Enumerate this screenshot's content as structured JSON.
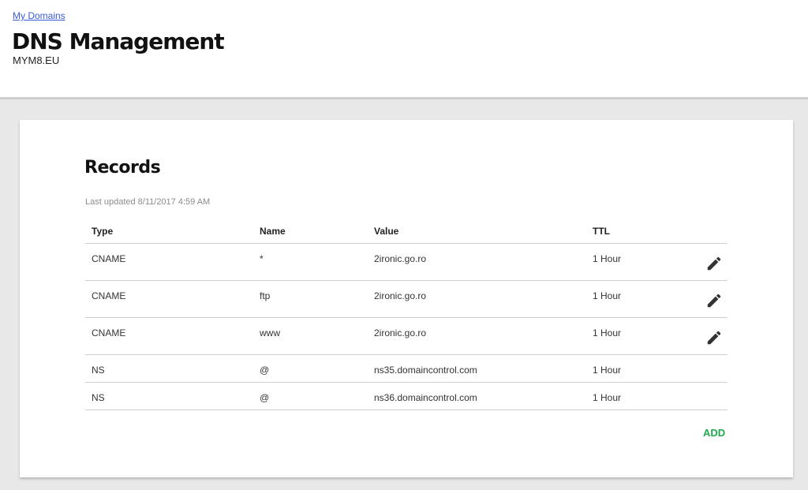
{
  "header": {
    "breadcrumb": "My Domains",
    "title": "DNS Management",
    "domain": "MYM8.EU"
  },
  "records": {
    "title": "Records",
    "last_updated": "Last updated 8/11/2017 4:59 AM",
    "columns": {
      "type": "Type",
      "name": "Name",
      "value": "Value",
      "ttl": "TTL"
    },
    "rows": [
      {
        "type": "CNAME",
        "name": "*",
        "value": "2ironic.go.ro",
        "ttl": "1 Hour",
        "editable": true
      },
      {
        "type": "CNAME",
        "name": "ftp",
        "value": "2ironic.go.ro",
        "ttl": "1 Hour",
        "editable": true
      },
      {
        "type": "CNAME",
        "name": "www",
        "value": "2ironic.go.ro",
        "ttl": "1 Hour",
        "editable": true
      },
      {
        "type": "NS",
        "name": "@",
        "value": "ns35.domaincontrol.com",
        "ttl": "1 Hour",
        "editable": false
      },
      {
        "type": "NS",
        "name": "@",
        "value": "ns36.domaincontrol.com",
        "ttl": "1 Hour",
        "editable": false
      }
    ],
    "add_label": "ADD",
    "edit_icon": "pencil-icon"
  },
  "colors": {
    "link": "#3b5bdb",
    "add_accent": "#1faa4d",
    "background": "#e8e8e8"
  }
}
